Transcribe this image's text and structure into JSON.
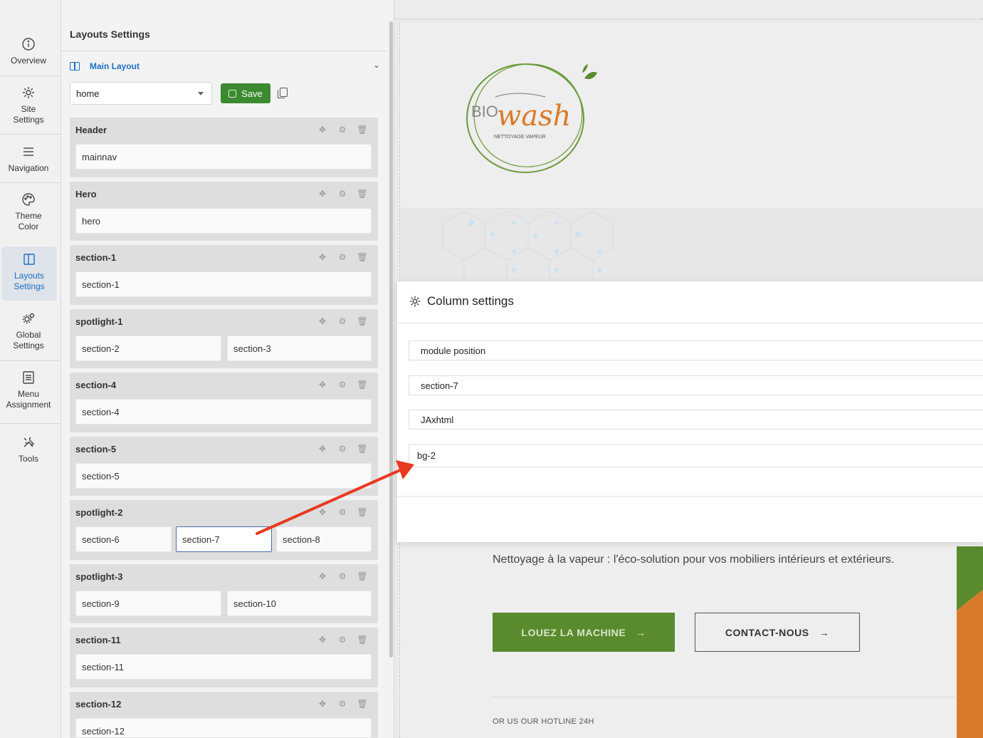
{
  "rail": {
    "items": [
      {
        "label": "Overview",
        "icon": "info-icon"
      },
      {
        "label": "Site\nSettings",
        "icon": "gear-icon"
      },
      {
        "label": "Navigation",
        "icon": "menu-icon"
      },
      {
        "label": "Theme\nColor",
        "icon": "palette-icon"
      },
      {
        "label": "Layouts\nSettings",
        "icon": "layout-icon",
        "active": true
      },
      {
        "label": "Global\nSettings",
        "icon": "gears-icon"
      },
      {
        "label": "Menu\nAssignment",
        "icon": "list-icon"
      },
      {
        "label": "Tools",
        "icon": "tools-icon"
      }
    ]
  },
  "panel": {
    "title": "Layouts Settings",
    "main_layout": "Main Layout",
    "layout_select": "home",
    "save_label": "Save",
    "sections": [
      {
        "name": "Header",
        "cols": [
          "mainnav"
        ]
      },
      {
        "name": "Hero",
        "cols": [
          "hero"
        ]
      },
      {
        "name": "section-1",
        "cols": [
          "section-1"
        ]
      },
      {
        "name": "spotlight-1",
        "cols": [
          "section-2",
          "section-3"
        ]
      },
      {
        "name": "section-4",
        "cols": [
          "section-4"
        ]
      },
      {
        "name": "section-5",
        "cols": [
          "section-5"
        ]
      },
      {
        "name": "spotlight-2",
        "cols": [
          "section-6",
          "section-7",
          "section-8"
        ],
        "selected": "section-7"
      },
      {
        "name": "spotlight-3",
        "cols": [
          "section-9",
          "section-10"
        ]
      },
      {
        "name": "section-11",
        "cols": [
          "section-11"
        ]
      },
      {
        "name": "section-12",
        "cols": [
          "section-12"
        ]
      }
    ]
  },
  "dialog": {
    "title": "Column settings",
    "fields": [
      "module position",
      "section-7",
      "JAxhtml",
      "bg-2"
    ]
  },
  "preview": {
    "logo_text_1": "BIO",
    "logo_text_2": "wash",
    "logo_tagline": "NETTOYAGE VAPEUR",
    "hero_text": "Nettoyage à la vapeur : l'éco-solution pour vos mobiliers intérieurs et extérieurs.",
    "btn_primary": "LOUEZ LA MACHINE",
    "btn_secondary": "CONTACT-NOUS",
    "hotline": "OR US OUR HOTLINE 24H"
  },
  "colors": {
    "accent": "#1e6fc3",
    "save_green": "#3b8a2f",
    "brand_green": "#5a8a2e",
    "brand_orange": "#d97a2b",
    "arrow_red": "#e83a1f"
  }
}
